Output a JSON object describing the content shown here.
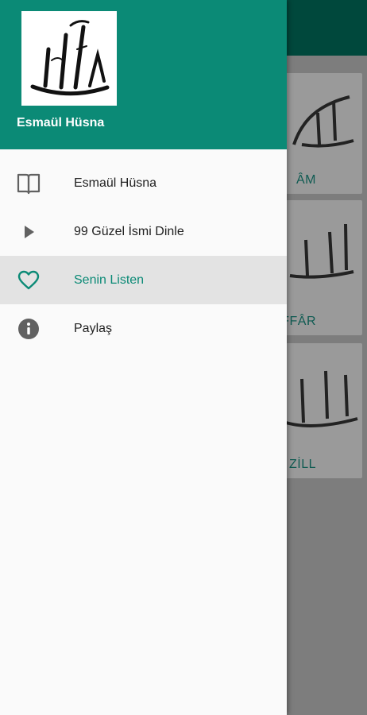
{
  "drawer": {
    "header": {
      "title": "Esmaül Hüsna"
    },
    "items": [
      {
        "label": "Esmaül Hüsna",
        "icon": "book-open-icon",
        "active": false
      },
      {
        "label": "99 Güzel İsmi Dinle",
        "icon": "play-icon",
        "active": false
      },
      {
        "label": "Senin Listen",
        "icon": "heart-outline-icon",
        "active": true
      },
      {
        "label": "Paylaş",
        "icon": "info-icon",
        "active": false
      }
    ]
  },
  "background": {
    "cards": [
      {
        "name_partial": "ÂM"
      },
      {
        "name_partial": "FFÂR"
      },
      {
        "name_partial": "ZİLL"
      }
    ]
  },
  "colors": {
    "primary": "#0b8a76",
    "primary_dark": "#00483c",
    "active_bg": "#e3e3e3",
    "icon_gray": "#616161"
  }
}
